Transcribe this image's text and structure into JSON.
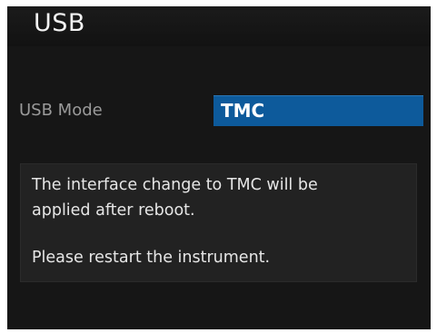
{
  "title": "USB",
  "setting": {
    "label": "USB Mode",
    "value": "TMC"
  },
  "message": {
    "line1": "The interface change to TMC will be",
    "line2": "applied after reboot.",
    "line3": "Please restart the instrument."
  },
  "colors": {
    "screen_background": "#161616",
    "value_highlight": "#0d5a9b",
    "message_box": "#222222",
    "text": "#e6e6e6",
    "label_text": "#9a9a9a"
  }
}
